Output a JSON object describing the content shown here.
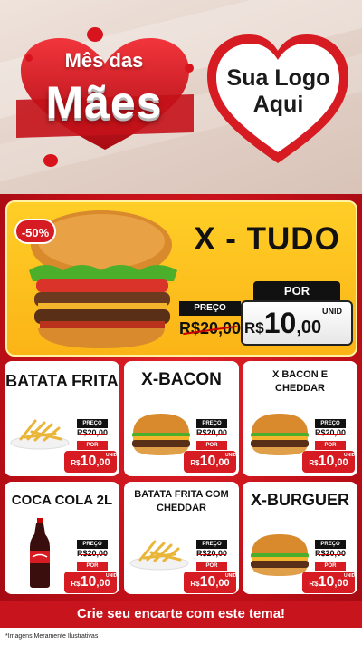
{
  "header": {
    "title_small": "Mês das",
    "title_big": "Mães",
    "logo_line1": "Sua Logo",
    "logo_line2": "Aqui"
  },
  "hero": {
    "discount": "-50%",
    "name": "X - TUDO",
    "preco_label": "PREÇO",
    "old_price": "R$20,00",
    "por_label": "POR",
    "currency": "R$",
    "price_int": "10",
    "price_dec": ",00",
    "unit": "UNID"
  },
  "products": [
    {
      "name": "BATATA FRITA",
      "preco_label": "PREÇO",
      "old_price": "R$20,00",
      "por_label": "POR",
      "currency": "R$",
      "price_int": "10",
      "price_dec": ",00",
      "unit": "UNID",
      "image": "fries-icon"
    },
    {
      "name": "X-BACON",
      "preco_label": "PREÇO",
      "old_price": "R$20,00",
      "por_label": "POR",
      "currency": "R$",
      "price_int": "10",
      "price_dec": ",00",
      "unit": "UNID",
      "image": "burger-icon"
    },
    {
      "name_line1": "X BACON E",
      "name_line2": "CHEDDAR",
      "preco_label": "PREÇO",
      "old_price": "R$20,00",
      "por_label": "POR",
      "currency": "R$",
      "price_int": "10",
      "price_dec": ",00",
      "unit": "UNID",
      "image": "burger-icon"
    },
    {
      "name": "COCA COLA 2L",
      "preco_label": "PREÇO",
      "old_price": "R$20,00",
      "por_label": "POR",
      "currency": "R$",
      "price_int": "10",
      "price_dec": ",00",
      "unit": "UNID",
      "image": "soda-bottle-icon"
    },
    {
      "name_line1": "BATATA FRITA COM",
      "name_line2": "CHEDDAR",
      "preco_label": "PREÇO",
      "old_price": "R$20,00",
      "por_label": "POR",
      "currency": "R$",
      "price_int": "10",
      "price_dec": ",00",
      "unit": "UNID",
      "image": "fries-icon"
    },
    {
      "name": "X-BURGUER",
      "preco_label": "PREÇO",
      "old_price": "R$20,00",
      "por_label": "POR",
      "currency": "R$",
      "price_int": "10",
      "price_dec": ",00",
      "unit": "UNID",
      "image": "burger-icon"
    }
  ],
  "footer": {
    "cta": "Crie seu encarte com este tema!",
    "disclaimer": "*Imagens Meramente Ilustrativas"
  },
  "colors": {
    "brand_red": "#d61c22",
    "hero_yellow": "#fbb416",
    "dark": "#111111"
  }
}
